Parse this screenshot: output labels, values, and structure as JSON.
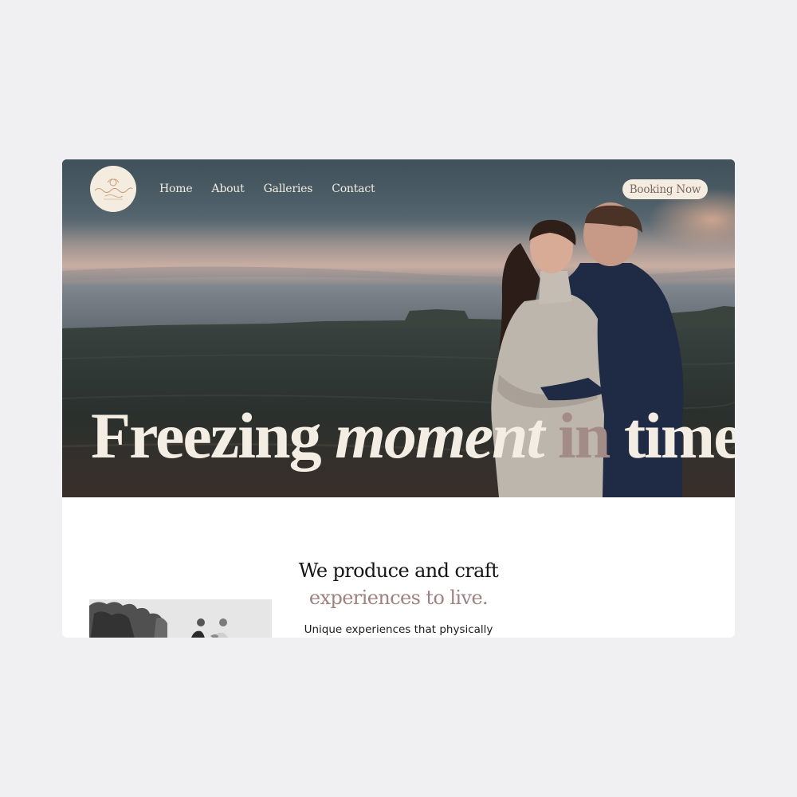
{
  "nav": {
    "items": [
      "Home",
      "About",
      "Galleries",
      "Contact"
    ],
    "cta_label": "Booking Now"
  },
  "hero": {
    "headline_part1": "Freezing ",
    "headline_part2": "moment",
    "headline_part3": "in",
    "headline_part4": " time"
  },
  "intro": {
    "title_line1": "We produce and craft",
    "title_line2": "experiences to live.",
    "body": "Unique experiences that physically"
  },
  "colors": {
    "page_bg": "#f0f0f3",
    "cream": "#f4ecde",
    "accent": "#9e8280",
    "text_dark": "#141414"
  }
}
